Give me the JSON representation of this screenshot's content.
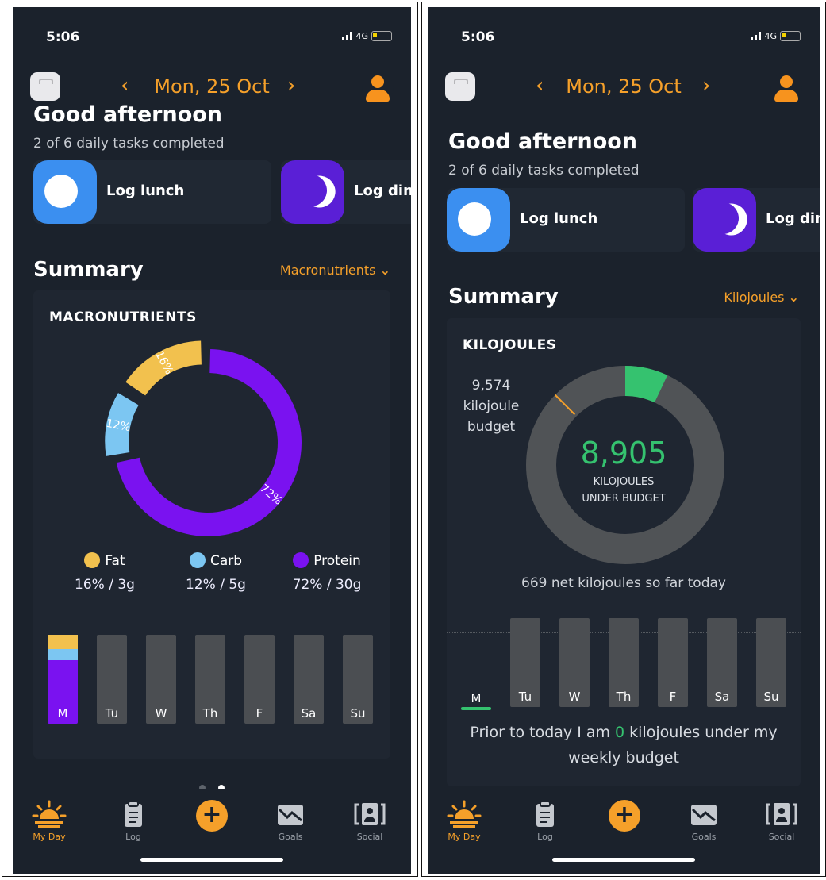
{
  "left": {
    "status": {
      "time": "5:06",
      "network": "4G"
    },
    "date": "Mon, 25 Oct",
    "greeting": "Good afternoon",
    "tasks_completed": "2 of 6 daily tasks completed",
    "tasks": [
      {
        "label": "Log lunch",
        "color": "#3b8ff0"
      },
      {
        "label": "Log dinr",
        "color": "#5a1fd6"
      }
    ],
    "summary_title": "Summary",
    "dropdown": "Macronutrients",
    "card_title": "MACRONUTRIENTS",
    "macros": [
      {
        "name": "Fat",
        "value": "16% / 3g",
        "color": "#f2c14e"
      },
      {
        "name": "Carb",
        "value": "12% / 5g",
        "color": "#7cc6f2"
      },
      {
        "name": "Protein",
        "value": "72% / 30g",
        "color": "#7a12f0"
      }
    ],
    "days": [
      "M",
      "Tu",
      "W",
      "Th",
      "F",
      "Sa",
      "Su"
    ],
    "tabs": [
      "My Day",
      "Log",
      "Goals",
      "Social"
    ]
  },
  "right": {
    "status": {
      "time": "5:06",
      "network": "4G"
    },
    "date": "Mon, 25 Oct",
    "greeting": "Good afternoon",
    "tasks_completed": "2 of 6 daily tasks completed",
    "tasks": [
      {
        "label": "Log lunch",
        "color": "#3b8ff0"
      },
      {
        "label": "Log dinr",
        "color": "#5a1fd6"
      }
    ],
    "summary_title": "Summary",
    "dropdown": "Kilojoules",
    "card_title": "KILOJOULES",
    "budget_value": "9,574",
    "budget_label_1": "kilojoule",
    "budget_label_2": "budget",
    "under_value": "8,905",
    "under_label_1": "KILOJOULES",
    "under_label_2": "UNDER BUDGET",
    "net_text": "669 net kilojoules so far today",
    "days": [
      "M",
      "Tu",
      "W",
      "Th",
      "F",
      "Sa",
      "Su"
    ],
    "prior_1": "Prior to today I am ",
    "prior_zero": "0",
    "prior_2": " kilojoules under my",
    "prior_3": "weekly budget",
    "tabs": [
      "My Day",
      "Log",
      "Goals",
      "Social"
    ]
  },
  "chart_data": [
    {
      "type": "pie",
      "title": "MACRONUTRIENTS",
      "categories": [
        "Fat",
        "Carb",
        "Protein"
      ],
      "values": [
        16,
        12,
        72
      ],
      "slice_labels": [
        "16%",
        "12%",
        "72%"
      ],
      "colors": [
        "#f2c14e",
        "#7cc6f2",
        "#7a12f0"
      ]
    },
    {
      "type": "pie",
      "title": "KILOJOULES",
      "budget": 9574,
      "net_consumed": 669,
      "under_budget": 8905,
      "colors": [
        "#35c26f",
        "#505356"
      ]
    }
  ]
}
